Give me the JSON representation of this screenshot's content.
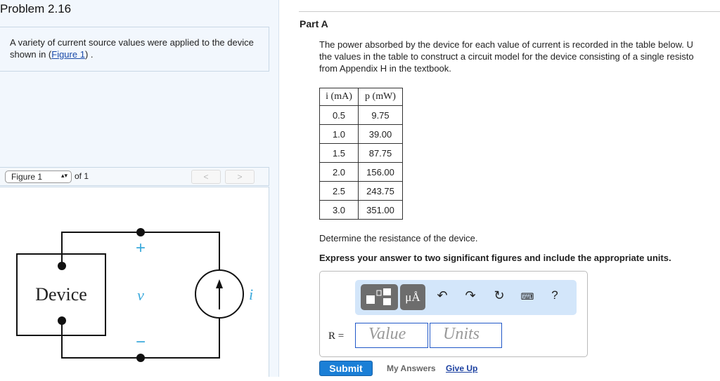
{
  "problem": {
    "title": "Problem 2.16",
    "desc_before": "A variety of current source values were applied to the device shown in (",
    "figure_link": "Figure 1",
    "desc_after": ") ."
  },
  "figure_nav": {
    "selected": "Figure 1",
    "of_label": "of 1",
    "prev": "<",
    "next": ">"
  },
  "circuit": {
    "device_label": "Device",
    "plus": "+",
    "voltage": "v",
    "minus": "−",
    "current": "i"
  },
  "part": {
    "title": "Part A",
    "intro_lines": [
      "The power absorbed by the device for each value of current is recorded in the table below. U",
      "the values in the table to construct a circuit model for the device consisting of a single resisto",
      "from Appendix H in the textbook."
    ],
    "table": {
      "headers": [
        "i (mA)",
        "p (mW)"
      ],
      "rows": [
        [
          "0.5",
          "9.75"
        ],
        [
          "1.0",
          "39.00"
        ],
        [
          "1.5",
          "87.75"
        ],
        [
          "2.0",
          "156.00"
        ],
        [
          "2.5",
          "243.75"
        ],
        [
          "3.0",
          "351.00"
        ]
      ]
    },
    "question": "Determine the resistance of the device.",
    "instruction": "Express your answer to two significant figures and include the appropriate units.",
    "answer": {
      "label": "R =",
      "value_placeholder": "Value",
      "units_placeholder": "Units",
      "units_btn": "μÅ",
      "help": "?"
    },
    "submit": "Submit",
    "my_answers": "My Answers",
    "give_up": "Give Up"
  }
}
